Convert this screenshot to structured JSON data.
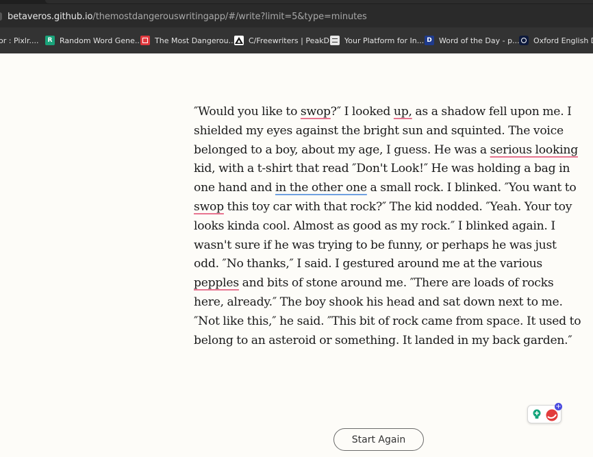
{
  "browser": {
    "url_host": "betaveros.github.io",
    "url_path": "/themostdangerouswritingapp/#/write?limit=5&type=minutes"
  },
  "bookmarks": [
    {
      "label": "or : Pixlr....",
      "icon": "pixlr-icon"
    },
    {
      "label": "Random Word Gene...",
      "icon": "random-word-icon"
    },
    {
      "label": "The Most Dangerou...",
      "icon": "dangerous-writing-icon"
    },
    {
      "label": "C/Freewriters | PeakD",
      "icon": "peakd-icon"
    },
    {
      "label": "Your Platform for In...",
      "icon": "platform-icon"
    },
    {
      "label": "Word of the Day - p...",
      "icon": "dictionary-icon"
    },
    {
      "label": "Oxford English Dic",
      "icon": "oed-icon"
    }
  ],
  "story": {
    "lines": [
      [
        {
          "t": "″Would you like to "
        },
        {
          "t": "swop",
          "m": "spell"
        },
        {
          "t": "?″ I looked "
        },
        {
          "t": "up,",
          "m": "spell"
        },
        {
          "t": " as a shadow fell upon me. I"
        }
      ],
      [
        {
          "t": "shielded my eyes against the bright sun and squinted. The voice"
        }
      ],
      [
        {
          "t": "belonged to a boy, about my age, I guess. He was a "
        },
        {
          "t": "serious looking",
          "m": "spell"
        }
      ],
      [
        {
          "t": "kid, with a t-shirt that read ″Don't Look!″ He was holding a bag in"
        }
      ],
      [
        {
          "t": "one hand and "
        },
        {
          "t": "in the other one",
          "m": "grammar"
        },
        {
          "t": " a small rock. I blinked. ″You want to"
        }
      ],
      [
        {
          "t": "swop",
          "m": "spell"
        },
        {
          "t": " this toy car with that rock?″ The kid nodded. ″Yeah. Your toy"
        }
      ],
      [
        {
          "t": "looks kinda cool. Almost as good as my rock.″ I blinked again. I"
        }
      ],
      [
        {
          "t": "wasn't sure if he was trying to be funny, or perhaps he was just"
        }
      ],
      [
        {
          "t": "odd. ″No thanks,″ I said. I gestured around me at the various"
        }
      ],
      [
        {
          "t": "pepples",
          "m": "spell"
        },
        {
          "t": " and bits of stone around me. ″There are loads of rocks"
        }
      ],
      [
        {
          "t": "here, already.″ The boy shook his head and sat down next to me."
        }
      ],
      [
        {
          "t": "″Not like this,″ he said. ″This bit of rock came from space. It used to"
        }
      ],
      [
        {
          "t": "belong to an asteroid or something. It landed in my back garden.″"
        }
      ]
    ]
  },
  "grammarly": {
    "badge": "+",
    "icon": "grammarly-icon"
  },
  "actions": {
    "start_again_label": "Start Again"
  },
  "colors": {
    "spelling_underline": "#e8738f",
    "grammar_underline": "#6fa0e0",
    "page_background": "#fdfcf8"
  }
}
